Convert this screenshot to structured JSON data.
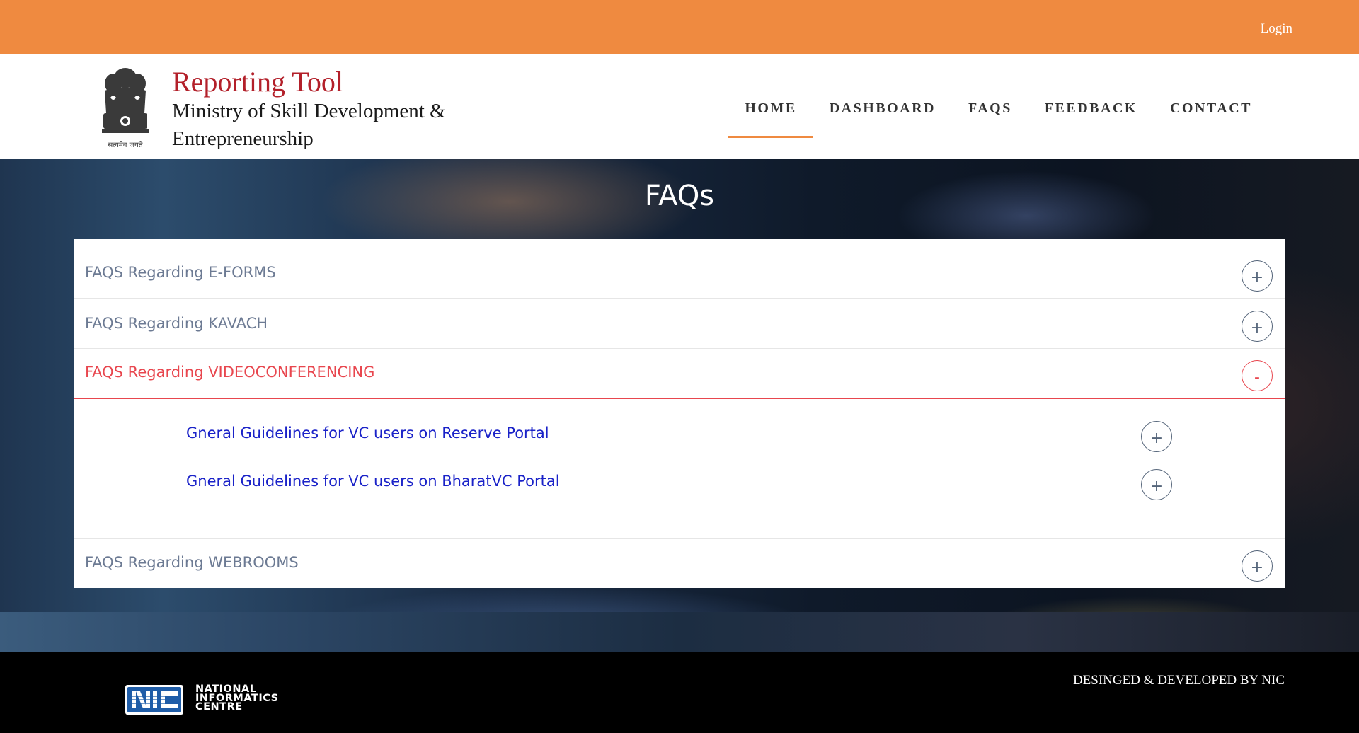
{
  "topbar": {
    "login_label": "Login"
  },
  "header": {
    "brand_title": "Reporting Tool",
    "brand_subtitle": "Ministry of Skill Development & Entrepreneurship",
    "emblem_caption": "सत्यमेव जयते",
    "nav": [
      "HOME",
      "DASHBOARD",
      "FAQS",
      "FEEDBACK",
      "CONTACT"
    ],
    "active_nav": "HOME"
  },
  "page": {
    "title": "FAQs"
  },
  "faq": {
    "sections": [
      {
        "label": "FAQS Regarding E-FORMS",
        "state": "+"
      },
      {
        "label": "FAQS Regarding KAVACH",
        "state": "+"
      },
      {
        "label": "FAQS Regarding VIDEOCONFERENCING",
        "state": "-"
      },
      {
        "label": "FAQS Regarding WEBROOMS",
        "state": "+"
      }
    ],
    "sub_items": [
      {
        "label": "Gneral Guidelines for VC users on Reserve Portal",
        "state": "+"
      },
      {
        "label": "Gneral Guidelines for VC users on BharatVC Portal",
        "state": "+"
      }
    ]
  },
  "footer": {
    "logo_lines": [
      "NATIONAL",
      "INFORMATICS",
      "CENTRE"
    ],
    "credit": "DESINGED & DEVELOPED BY NIC"
  },
  "colors": {
    "topbar": "#ef8a40",
    "brand": "#b3202a",
    "open_accent": "#e8464e",
    "link": "#1a22c8"
  }
}
